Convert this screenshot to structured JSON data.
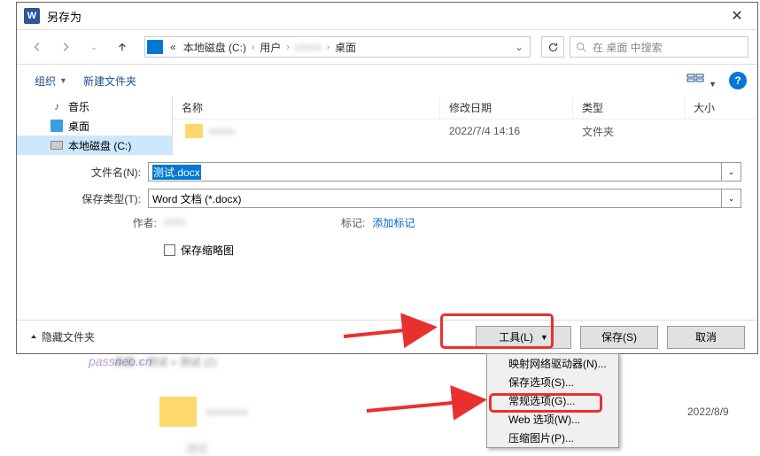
{
  "titlebar": {
    "title": "另存为"
  },
  "breadcrumb": {
    "root": "«",
    "items": [
      "本地磁盘 (C:)",
      "用户",
      "",
      "桌面"
    ],
    "refresh_dropdown": "⌄"
  },
  "search": {
    "placeholder": "在 桌面 中搜索"
  },
  "toolbar": {
    "organize": "组织",
    "newfolder": "新建文件夹",
    "help": "?"
  },
  "sidebar": {
    "items": [
      {
        "label": "音乐",
        "icon": "music"
      },
      {
        "label": "桌面",
        "icon": "desktop"
      },
      {
        "label": "本地磁盘 (C:)",
        "icon": "disk",
        "selected": true
      }
    ]
  },
  "headers": {
    "name": "名称",
    "date": "修改日期",
    "type": "类型",
    "size": "大小"
  },
  "files": [
    {
      "name": "xxxxx",
      "date": "2022/7/4 14:16",
      "type": "文件夹"
    }
  ],
  "form": {
    "filename_label": "文件名(N):",
    "filename_value": "测试.docx",
    "filetype_label": "保存类型(T):",
    "filetype_value": "Word 文档 (*.docx)",
    "author_label": "作者:",
    "author_value": "xxxx",
    "tag_label": "标记:",
    "tag_value": "添加标记",
    "thumbnail": "保存缩略图"
  },
  "footer": {
    "hide": "隐藏文件夹",
    "tools": "工具(L)",
    "save": "保存(S)",
    "cancel": "取消"
  },
  "menu": {
    "items": [
      "映射网络驱动器(N)...",
      "保存选项(S)...",
      "常规选项(G)...",
      "Web 选项(W)...",
      "压缩图片(P)..."
    ]
  },
  "watermark": "passneo.cn",
  "below": {
    "crumb": "桌面 » 测试 » 测试 (2)",
    "date": "2022/8/9"
  }
}
